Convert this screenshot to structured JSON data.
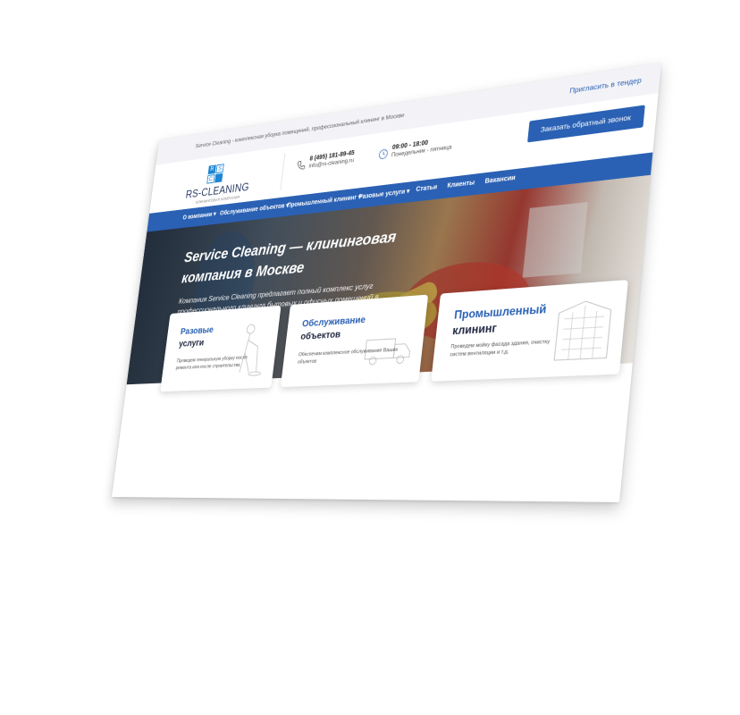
{
  "topbar": {
    "tagline": "Service Cleaning - комплексная уборка помещений, профессиональный клининг в Москве",
    "tender_link": "Пригласить в тендер"
  },
  "logo": {
    "tiles": [
      "R",
      "S",
      "C",
      ""
    ],
    "name": "RS-CLEANING",
    "subtitle": "КЛИНИНГОВАЯ КОМПАНИЯ"
  },
  "contacts": {
    "phone": "8 (495) 181-89-45",
    "email": "info@rs-cleaning.ru",
    "hours": "09:00 - 18:00",
    "days": "Понедельник - пятница",
    "phone_icon": "phone-icon",
    "clock_icon": "clock-icon"
  },
  "callback_button": "Заказать обратный звонок",
  "nav": {
    "items": [
      "О компании ▾",
      "Обслуживание объектов ▾",
      "Промышленный клининг ▾",
      "Разовые услуги ▾",
      "Статьи",
      "Клиенты",
      "Вакансии"
    ]
  },
  "hero": {
    "title": "Service Cleaning — клининговая компания в Москве",
    "text": "Компания Service Cleaning предлагает полный комплекс услуг профессионального клининга бытовых и офисных помещений в Москве."
  },
  "cards": [
    {
      "title_line1": "Разовые",
      "title_line2": "услуги",
      "desc": "Проведем генеральную уборку после ремонта или после строительства",
      "art": "cleaner-sketch"
    },
    {
      "title_line1": "Обслуживание",
      "title_line2": "объектов",
      "desc": "Обеспечим комплексное обслуживание Ваших объектов",
      "art": "truck-sketch"
    },
    {
      "title_line1": "Промышленный",
      "title_line2": "клининг",
      "desc": "Проведем мойку фасада здания, очистку систем вентиляции и т.д.",
      "art": "building-sketch"
    }
  ],
  "colors": {
    "brand_blue": "#2a61b4",
    "logo_blue": "#1e86d4",
    "dark_title": "#1e2540"
  }
}
